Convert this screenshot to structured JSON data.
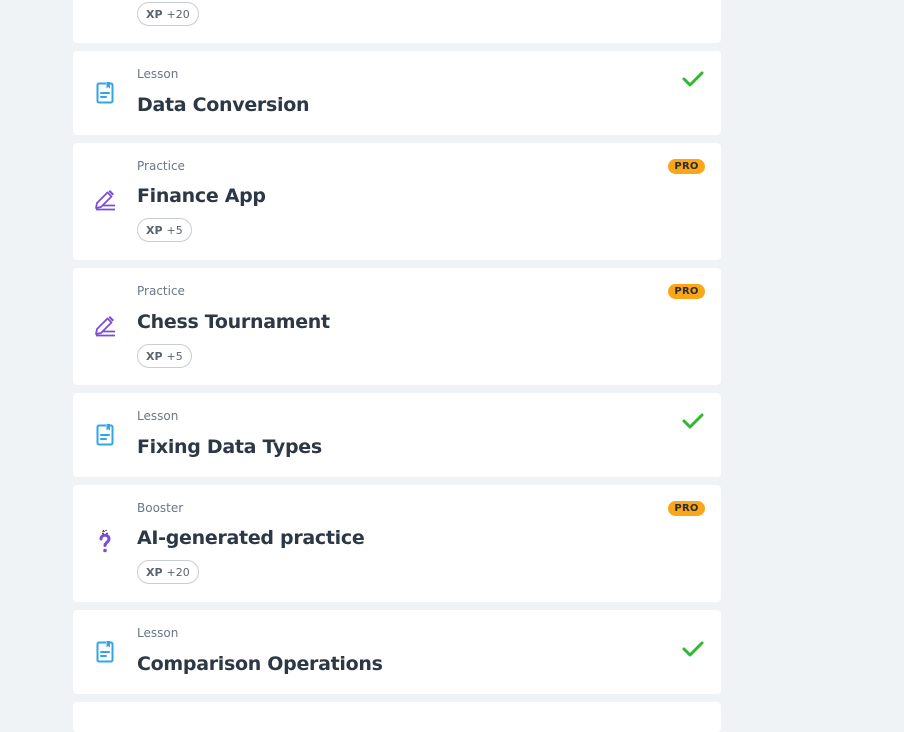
{
  "colors": {
    "background": "#f0f3f6",
    "card": "#ffffff",
    "lesson_icon": "#2fa6e8",
    "practice_icon": "#7a4fd6",
    "check": "#2fb92f",
    "pro": "#f9a61a"
  },
  "items": [
    {
      "type": "",
      "title": "",
      "xp_label": "XP",
      "xp_value": "+20",
      "status": "",
      "icon": "none"
    },
    {
      "type": "Lesson",
      "title": "Data Conversion",
      "status": "completed",
      "icon": "lesson-document-icon"
    },
    {
      "type": "Practice",
      "title": "Finance App",
      "xp_label": "XP",
      "xp_value": "+5",
      "pro_label": "PRO",
      "icon": "practice-pencil-icon"
    },
    {
      "type": "Practice",
      "title": "Chess Tournament",
      "xp_label": "XP",
      "xp_value": "+5",
      "pro_label": "PRO",
      "icon": "practice-pencil-icon"
    },
    {
      "type": "Lesson",
      "title": "Fixing Data Types",
      "status": "completed",
      "icon": "lesson-document-icon"
    },
    {
      "type": "Booster",
      "title": "AI-generated practice",
      "xp_label": "XP",
      "xp_value": "+20",
      "pro_label": "PRO",
      "icon": "booster-question-icon"
    },
    {
      "type": "Lesson",
      "title": "Comparison Operations",
      "status": "completed",
      "icon": "lesson-document-icon"
    }
  ]
}
